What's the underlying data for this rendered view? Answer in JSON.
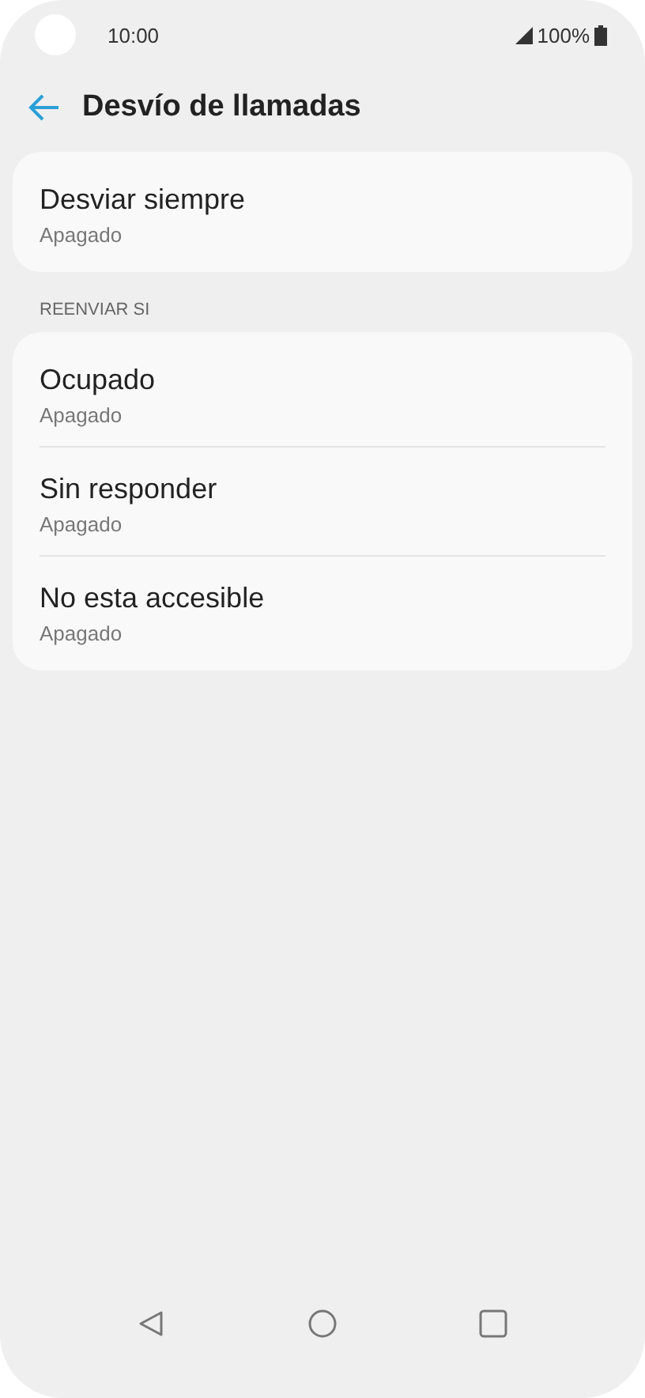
{
  "status_bar": {
    "time": "10:00",
    "battery": "100%"
  },
  "header": {
    "title": "Desvío de llamadas"
  },
  "sections": [
    {
      "items": [
        {
          "title": "Desviar siempre",
          "summary": "Apagado"
        }
      ]
    },
    {
      "heading": "REENVIAR SI",
      "items": [
        {
          "title": "Ocupado",
          "summary": "Apagado"
        },
        {
          "title": "Sin responder",
          "summary": "Apagado"
        },
        {
          "title": "No esta accesible",
          "summary": "Apagado"
        }
      ]
    }
  ]
}
